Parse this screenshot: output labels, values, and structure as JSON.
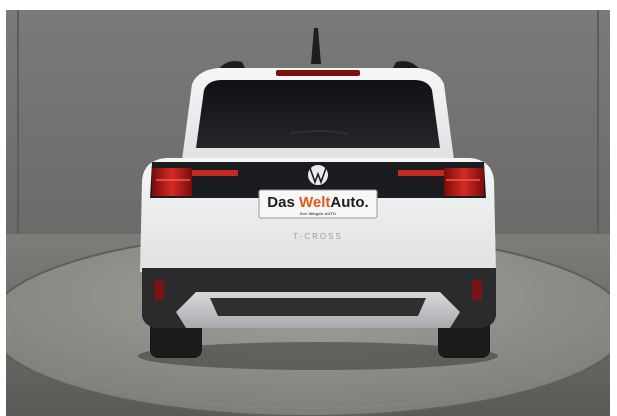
{
  "photo": {
    "subject": "rear view of white compact SUV on turntable in studio",
    "plate": {
      "brand_left": "Das ",
      "brand_mid": "Welt",
      "brand_right": "Auto.",
      "dealer_line": "Ihre Wiegele AUTO"
    },
    "model_badge": "T-CROSS",
    "colors": {
      "body": "#eef0f1",
      "glass": "#1a1b1e",
      "lights": "#c81e1e",
      "bumper": "#2c2c2e",
      "skid_plate": "#c8c9cb",
      "floor": "#8c8b87",
      "wall": "#757573"
    }
  }
}
